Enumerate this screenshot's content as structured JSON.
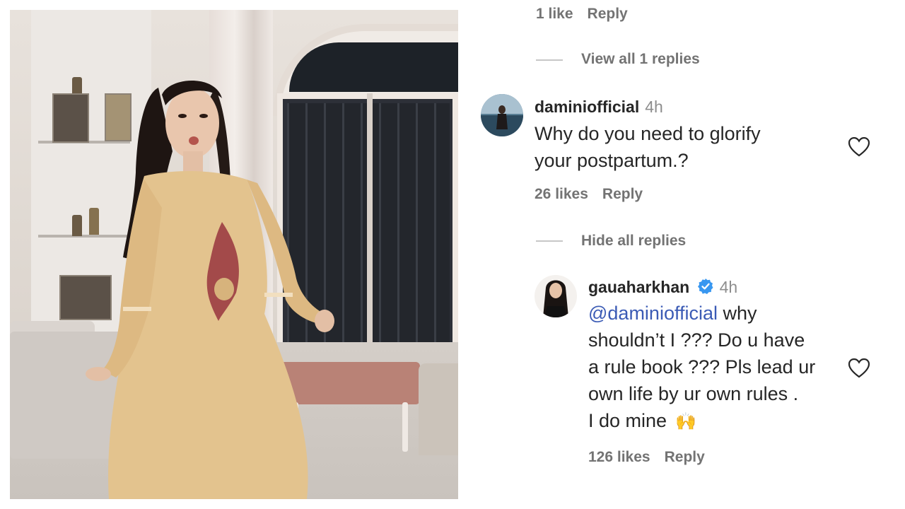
{
  "video": {
    "description_icon": "video-frame"
  },
  "top": {
    "likes_label": "1 like",
    "reply_label": "Reply"
  },
  "view_replies": {
    "label": "View all 1 replies"
  },
  "comment1": {
    "username": "daminiofficial",
    "time": "4h",
    "text_line1": "Why do you need to glorify",
    "text_line2": "your postpartum.?",
    "likes": "26 likes",
    "reply_label": "Reply"
  },
  "hide_replies": {
    "label": "Hide all replies"
  },
  "reply1": {
    "username": "gauaharkhan",
    "time": "4h",
    "mention": "@daminiofficial",
    "line1_rest": " why",
    "line2": "shouldn’t I ??? Do u have",
    "line3": "a rule book ??? Pls lead ur",
    "line4": "own life by ur own rules .",
    "line5": "I do mine",
    "emoji": "🙌",
    "likes": "126 likes",
    "reply_label": "Reply"
  },
  "colors": {
    "mention": "#3b5bb5",
    "verified": "#3897f0",
    "meta": "#737373"
  }
}
